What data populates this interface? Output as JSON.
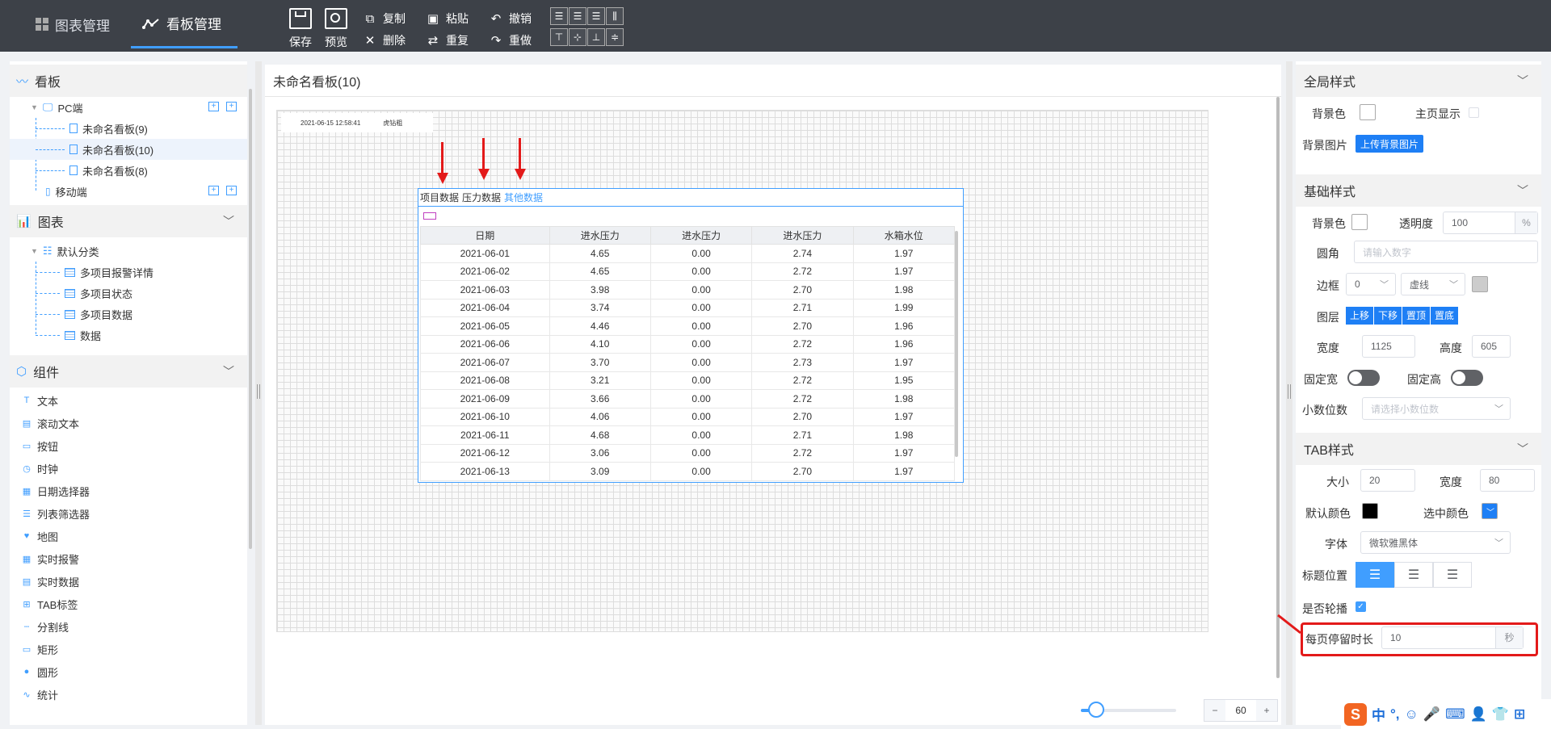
{
  "topnav": {
    "tabs": [
      {
        "label": "图表管理",
        "icon": "grid-icon"
      },
      {
        "label": "看板管理",
        "icon": "line-chart-icon"
      }
    ]
  },
  "toolbar": {
    "save": "保存",
    "preview": "预览",
    "copy": "复制",
    "paste": "粘贴",
    "undo": "撤销",
    "delete": "删除",
    "repeat": "重复",
    "redo": "重做"
  },
  "left": {
    "dashboard": {
      "title": "看板",
      "pc_label": "PC端",
      "items": [
        "未命名看板(9)",
        "未命名看板(10)",
        "未命名看板(8)"
      ],
      "mobile_label": "移动端"
    },
    "charts": {
      "title": "图表",
      "category": "默认分类",
      "items": [
        "多项目报警详情",
        "多项目状态",
        "多项目数据",
        "数据"
      ]
    },
    "components": {
      "title": "组件",
      "items": [
        "文本",
        "滚动文本",
        "按钮",
        "时钟",
        "日期选择器",
        "列表筛选器",
        "地图",
        "实时报警",
        "实时数据",
        "TAB标签",
        "分割线",
        "矩形",
        "圆形",
        "统计"
      ]
    }
  },
  "center": {
    "title": "未命名看板(10)",
    "clock_text": "2021-06-15 12:58:41",
    "clock_text2": "虎钻粗",
    "tabs": [
      "项目数据",
      "压力数据",
      "其他数据"
    ],
    "active_tab": "其他数据",
    "table": {
      "headers": [
        "日期",
        "进水压力",
        "进水压力",
        "进水压力",
        "水箱水位"
      ],
      "rows": [
        [
          "2021-06-01",
          "4.65",
          "0.00",
          "2.74",
          "1.97"
        ],
        [
          "2021-06-02",
          "4.65",
          "0.00",
          "2.72",
          "1.97"
        ],
        [
          "2021-06-03",
          "3.98",
          "0.00",
          "2.70",
          "1.98"
        ],
        [
          "2021-06-04",
          "3.74",
          "0.00",
          "2.71",
          "1.99"
        ],
        [
          "2021-06-05",
          "4.46",
          "0.00",
          "2.70",
          "1.96"
        ],
        [
          "2021-06-06",
          "4.10",
          "0.00",
          "2.72",
          "1.96"
        ],
        [
          "2021-06-07",
          "3.70",
          "0.00",
          "2.73",
          "1.97"
        ],
        [
          "2021-06-08",
          "3.21",
          "0.00",
          "2.72",
          "1.95"
        ],
        [
          "2021-06-09",
          "3.66",
          "0.00",
          "2.72",
          "1.98"
        ],
        [
          "2021-06-10",
          "4.06",
          "0.00",
          "2.70",
          "1.97"
        ],
        [
          "2021-06-11",
          "4.68",
          "0.00",
          "2.71",
          "1.98"
        ],
        [
          "2021-06-12",
          "3.06",
          "0.00",
          "2.72",
          "1.97"
        ],
        [
          "2021-06-13",
          "3.09",
          "0.00",
          "2.70",
          "1.97"
        ]
      ]
    },
    "zoom": {
      "minus": "−",
      "value": "60",
      "plus": "+",
      "slider_fraction": 0.16
    }
  },
  "right": {
    "global": {
      "title": "全局样式",
      "bg_color": "背景色",
      "home_display": "主页显示",
      "bg_image": "背景图片",
      "upload_btn": "上传背景图片"
    },
    "basic": {
      "title": "基础样式",
      "bg_color": "背景色",
      "opacity": "透明度",
      "opacity_value": "100",
      "opacity_unit": "%",
      "radius": "圆角",
      "radius_placeholder": "请输入数字",
      "border": "边框",
      "border_width": "0",
      "border_style": "虚线",
      "layer": "图层",
      "layer_btns": [
        "上移",
        "下移",
        "置顶",
        "置底"
      ],
      "width": "宽度",
      "width_value": "1125",
      "height": "高度",
      "height_value": "605",
      "fixed_width": "固定宽",
      "fixed_height": "固定高",
      "decimals": "小数位数",
      "decimals_placeholder": "请选择小数位数"
    },
    "tab": {
      "title": "TAB样式",
      "size": "大小",
      "size_value": "20",
      "width": "宽度",
      "width_value": "80",
      "default_color": "默认颜色",
      "default_color_value": "#000000",
      "selected_color": "选中颜色",
      "selected_color_value": "#1e7ff5",
      "font": "字体",
      "font_value": "微软雅黑体",
      "title_pos": "标题位置",
      "carousel": "是否轮播",
      "dwell": "每页停留时长",
      "dwell_value": "10",
      "dwell_unit": "秒"
    }
  },
  "ime": {
    "s": "S",
    "zh": "中",
    "punct": "°,"
  }
}
